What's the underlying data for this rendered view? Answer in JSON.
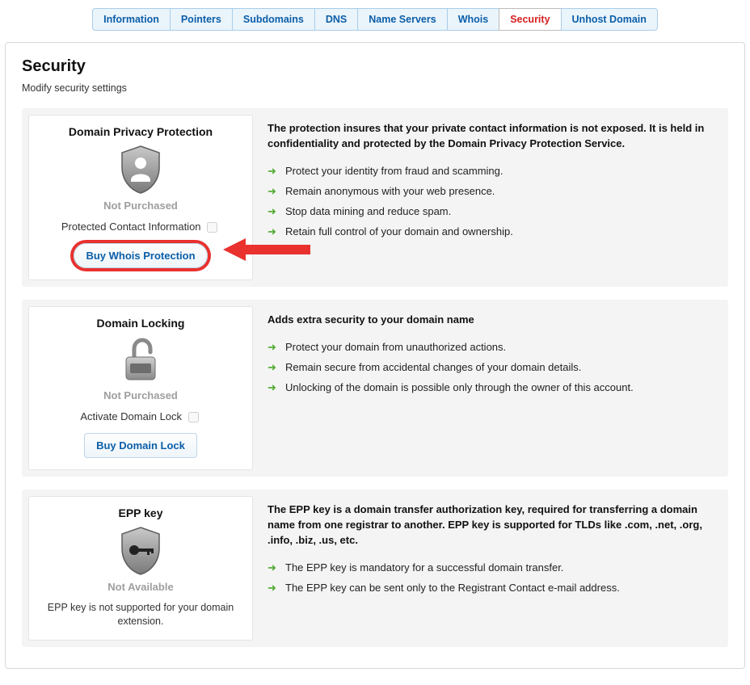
{
  "tabs": {
    "t0": "Information",
    "t1": "Pointers",
    "t2": "Subdomains",
    "t3": "DNS",
    "t4": "Name Servers",
    "t5": "Whois",
    "t6": "Security",
    "t7": "Unhost Domain"
  },
  "page": {
    "title": "Security",
    "subtitle": "Modify security settings"
  },
  "privacy": {
    "title": "Domain Privacy Protection",
    "status": "Not Purchased",
    "option_label": "Protected Contact Information",
    "button": "Buy Whois Protection",
    "desc": "The protection insures that your private contact information is not exposed. It is held in confidentiality and protected by the Domain Privacy Protection Service.",
    "b1": "Protect your identity from fraud and scamming.",
    "b2": "Remain anonymous with your web presence.",
    "b3": "Stop data mining and reduce spam.",
    "b4": "Retain full control of your domain and ownership."
  },
  "locking": {
    "title": "Domain Locking",
    "status": "Not Purchased",
    "option_label": "Activate Domain Lock",
    "button": "Buy Domain Lock",
    "desc": "Adds extra security to your domain name",
    "b1": "Protect your domain from unauthorized actions.",
    "b2": "Remain secure from accidental changes of your domain details.",
    "b3": "Unlocking of the domain is possible only through the owner of this account."
  },
  "epp": {
    "title": "EPP key",
    "status": "Not Available",
    "note": "EPP key is not supported for your domain extension.",
    "desc": "The EPP key is a domain transfer authorization key, required for transferring a domain name from one registrar to another. EPP key is supported for TLDs like .com, .net, .org, .info, .biz, .us, etc.",
    "b1": "The EPP key is mandatory for a successful domain transfer.",
    "b2": "The EPP key can be sent only to the Registrant Contact e-mail address."
  }
}
